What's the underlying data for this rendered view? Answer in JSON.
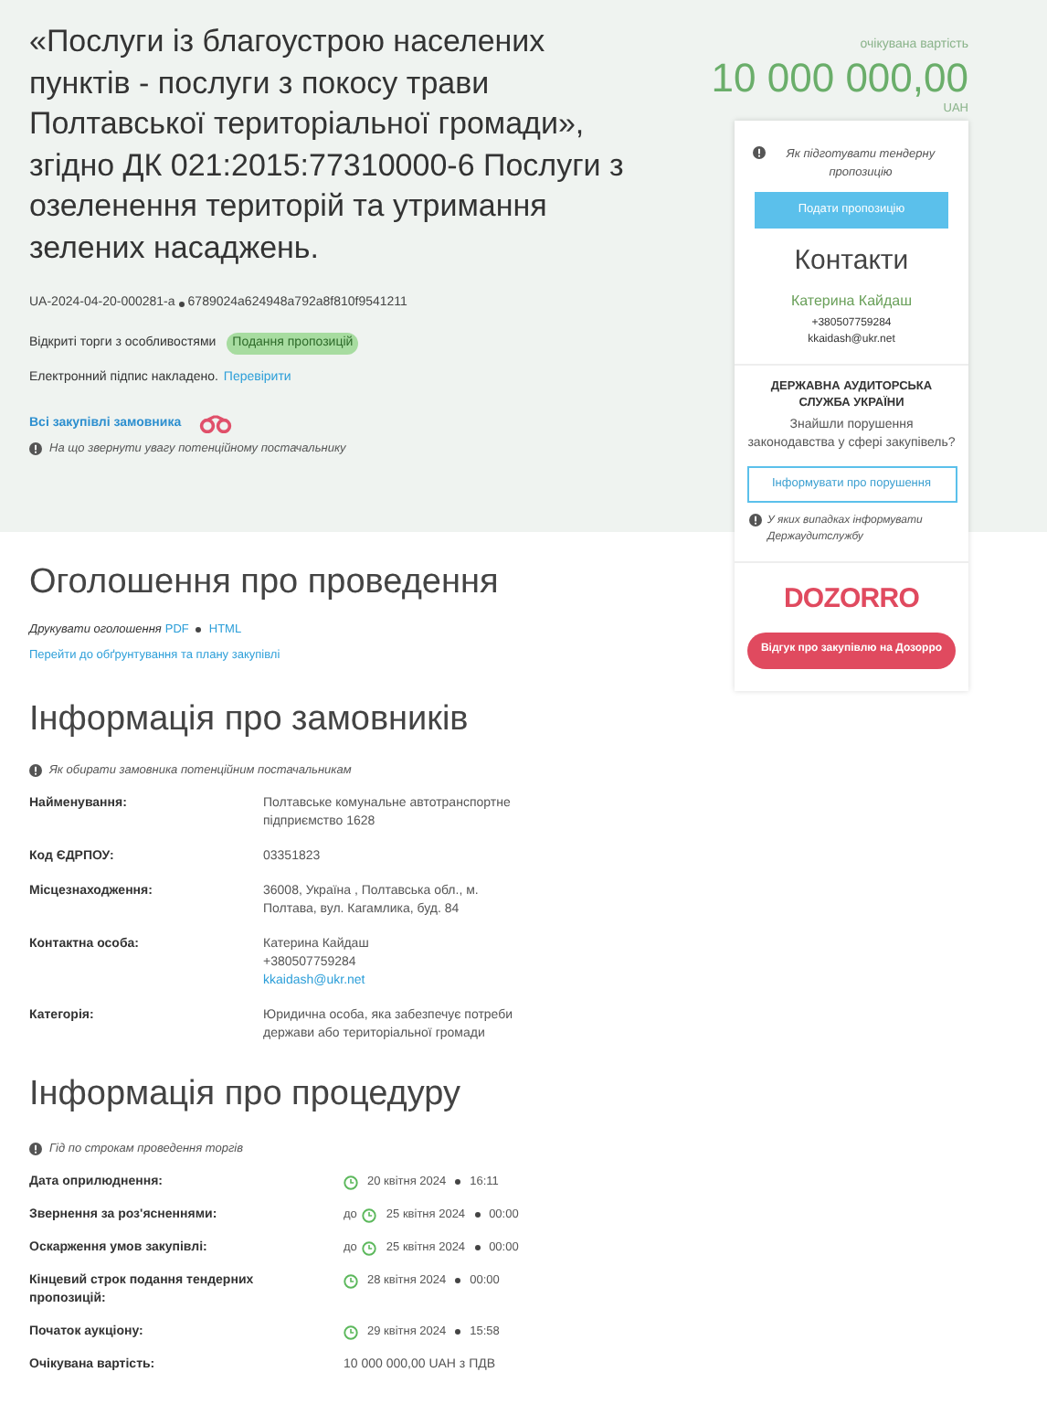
{
  "header": {
    "title": "«Послуги із благоустрою населених пунктів - послуги з покосу трави Полтавської територіальної громади», згідно ДК 021:2015:77310000-6 Послуги з озеленення територій та утримання зелених насаджень.",
    "ids": [
      "UA-2024-04-20-000281-a",
      "6789024a624948a792a8f810f9541211"
    ],
    "procedure_type": "Відкриті торги з особливостями",
    "status": "Подання пропозицій",
    "signature_text": "Електронний підпис накладено.",
    "signature_link": "Перевірити",
    "all_purchases_link": "Всі закупівлі замовника",
    "hint": "На що звернути увагу потенційному постачальнику"
  },
  "price": {
    "label": "очікувана вартість",
    "amount": "10 000 000,00",
    "currency": "UAH"
  },
  "sidebar": {
    "hint": "Як підготувати тендерну пропозицію",
    "submit_button": "Подати пропозицію",
    "contacts_title": "Контакти",
    "contact_name": "Катерина Кайдаш",
    "contact_phone": "+380507759284",
    "contact_email": "kkaidash@ukr.net",
    "audit_title": "ДЕРЖАВНА АУДИТОРСЬКА СЛУЖБА УКРАЇНИ",
    "audit_question": "Знайшли порушення законодавства у сфері закупівель?",
    "audit_button": "Інформувати про порушення",
    "audit_hint": "У яких випадках інформувати Держаудитслужбу",
    "dozorro_logo": "DOZORRO",
    "dozorro_button": "Відгук про закупівлю на Дозорро"
  },
  "announcement": {
    "title": "Оголошення про проведення",
    "print_label": "Друкувати оголошення",
    "print_links": [
      "PDF",
      "HTML"
    ],
    "plan_link": "Перейти до обґрунтування та плану закупівлі"
  },
  "customer": {
    "title": "Інформація про замовників",
    "hint": "Як обирати замовника потенційним постачальникам",
    "rows": [
      {
        "label": "Найменування:",
        "lines": [
          {
            "text": "Полтавське комунальне автотранспортне підприємство 1628",
            "link": false
          }
        ]
      },
      {
        "label": "Код ЄДРПОУ:",
        "lines": [
          {
            "text": "03351823",
            "link": false
          }
        ]
      },
      {
        "label": "Місцезнаходження:",
        "lines": [
          {
            "text": "36008, Україна , Полтавська обл., м. Полтава, вул. Кагамлика, буд. 84",
            "link": false
          }
        ]
      },
      {
        "label": "Контактна особа:",
        "lines": [
          {
            "text": "Катерина Кайдаш",
            "link": false
          },
          {
            "text": "+380507759284",
            "link": false
          },
          {
            "text": "kkaidash@ukr.net",
            "link": true
          }
        ]
      },
      {
        "label": "Категорія:",
        "lines": [
          {
            "text": "Юридична особа, яка забезпечує потреби держави або територіальної громади",
            "link": false
          }
        ]
      }
    ]
  },
  "procedure": {
    "title": "Інформація про процедуру",
    "hint": "Гід по строкам проведення торгів",
    "rows": [
      {
        "kind": "date",
        "label": "Дата оприлюднення:",
        "date": "20 квітня 2024",
        "time": "16:11"
      },
      {
        "kind": "date",
        "label": "Звернення за роз'ясненнями:",
        "prefix": "до",
        "date": "25 квітня 2024",
        "time": "00:00"
      },
      {
        "kind": "date",
        "label": "Оскарження умов закупівлі:",
        "prefix": "до",
        "date": "25 квітня 2024",
        "time": "00:00"
      },
      {
        "kind": "date",
        "label": "Кінцевий строк подання тендерних пропозицій:",
        "date": "28 квітня 2024",
        "time": "00:00"
      },
      {
        "kind": "date",
        "label": "Початок аукціону:",
        "date": "29 квітня 2024",
        "time": "15:58"
      },
      {
        "kind": "text",
        "label": "Очікувана вартість:",
        "value": "10 000 000,00 UAH з ПДВ"
      }
    ]
  }
}
